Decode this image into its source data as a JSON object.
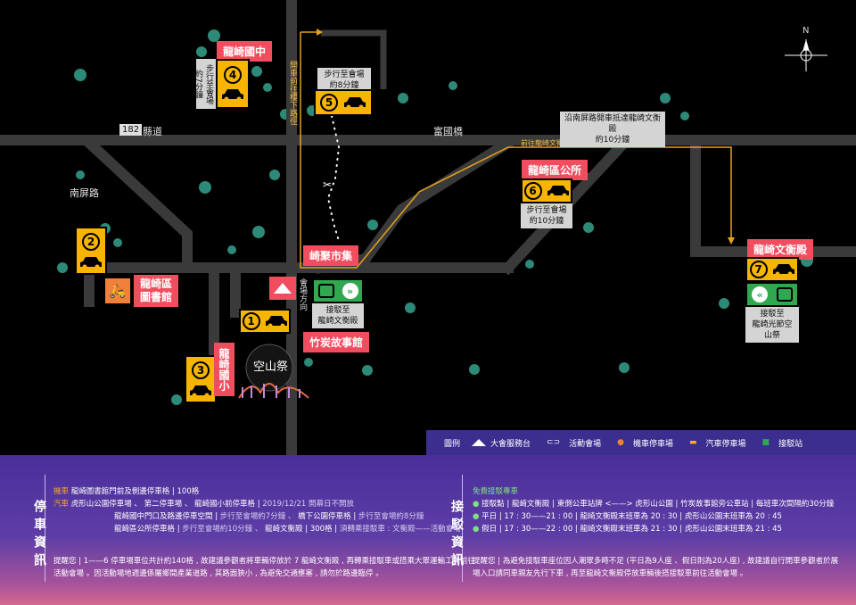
{
  "map": {
    "roads": {
      "county_road_num": "182",
      "county_road": "縣道",
      "fuguo_bridge": "富國橋",
      "nanping_road": "南屏路"
    },
    "routes": {
      "car_route_to_upper_lot": "開車前往樓下路徑",
      "route_to_wenheng": "前往龍崎文衡殿路徑",
      "car_route_note": "沿南屏路開車抵達龍崎文衡殿",
      "car_route_time": "約10分鐘",
      "venue_direction": "會場方向"
    },
    "places": {
      "longqi_junior_high": "龍崎國中",
      "district_office": "龍崎區公所",
      "wenheng_temple": "龍崎文衡殿",
      "library_line1": "龍崎區",
      "library_line2": "圖書館",
      "qiju_market": "崎聚市集",
      "charcoal_story": "竹炭故事館",
      "longqi_elementary": "龍崎國小",
      "festival_logo": "空山祭"
    },
    "markers": {
      "p1": "1",
      "p2": "2",
      "p3": "3",
      "p4": "4",
      "p5": "5",
      "p6": "6",
      "p7": "7"
    },
    "notes": {
      "p4_walk_line1": "步行至會場",
      "p4_walk_line2": "約7分鐘",
      "p5_walk_line1": "步行至會場",
      "p5_walk_line2": "約8分鐘",
      "p6_walk_line1": "步行至會場",
      "p6_walk_line2": "約10分鐘",
      "shuttle_to_line1": "接駁至",
      "shuttle_to_line2": "龍崎文衡殿",
      "p7_shuttle_line1": "接駁至",
      "p7_shuttle_line2": "龍崎光節空山祭"
    },
    "compass": "N"
  },
  "legend": {
    "title": "圖例",
    "service_desk": "大會服務台",
    "venue": "活動會場",
    "motorcycle": "機車停車場",
    "car": "汽車停車場",
    "shuttle": "接駁站"
  },
  "parking": {
    "title": "停車資訊",
    "moto_tag": "機車",
    "moto_text": "龍崎圖書館門前及側邊停車格",
    "moto_count": "100格",
    "car_tag": "汽車",
    "car_line1": "虎形山公園停車場 、",
    "car_line1b": "第二停車場 、",
    "car_line1c": "龍崎國小前停車格",
    "car_line1_note": "2019/12/21 開幕日不開放",
    "car_line2a": "龍崎國中門口及路邊停車空間",
    "car_line2a_note": "步行至會場約7分鐘 、",
    "car_line2b": "橋下公園停車格",
    "car_line2b_note": "步行至會場約8分鐘",
    "car_line3a": "龍崎區公所停車格",
    "car_line3a_note": "步行至會場約10分鐘 、",
    "car_line3b": "龍崎文衡殿",
    "car_line3b_count": "300格",
    "car_line3b_note": "須轉乘接駁車 : 文衡殿——活動會場",
    "reminder1": "提醒您 | 1——6 停車場車位共計約140格 , 故建議參觀者將車輛停放於 7 龍崎文衡殿 , 再轉乘接駁車或搭乘大眾運輸工具前往",
    "reminder2": "活動會場 。因活動場地週邊係屬鄉間產業道路 , 其路面狹小 , 為避免交通壅塞 , 請勿於路邊臨停 。"
  },
  "shuttle": {
    "title": "接駁資訊",
    "free_tag": "免費接駁專車",
    "stops_label": "接駁點",
    "stops_text": "龍崎文衡殿 | 東側公車站牌 <——> 虎形山公園 | 竹炭故事館旁公車站 | 每班車次間隔約30分鐘",
    "weekday_label": "平日",
    "weekday_text": "17 : 30——21 : 00 | 龍崎文衡殿末班車為 20 : 30 | 虎形山公園末班車為 20 : 45",
    "holiday_label": "假日",
    "holiday_text": "17 : 30——22 : 00 | 龍崎文衡殿末班車為 21 : 30 | 虎形山公園末班車為 21 : 45",
    "reminder1": "提醒您 | 為避免接駁車座位因人潮眾多時不足 (平日為9人座 、假日則為20人座) , 故建議自行開車參觀者於展",
    "reminder2": "場入口請同車親友先行下車 , 再至龍崎文衡殿停放車輛後搭接駁車前往活動會場 。"
  },
  "colors": {
    "accent_red": "#f04d5e",
    "parking_yellow": "#f7b400",
    "shuttle_green": "#2fa84f",
    "route_orange": "#e6a21a",
    "legend_purple": "#3b2e8f"
  }
}
